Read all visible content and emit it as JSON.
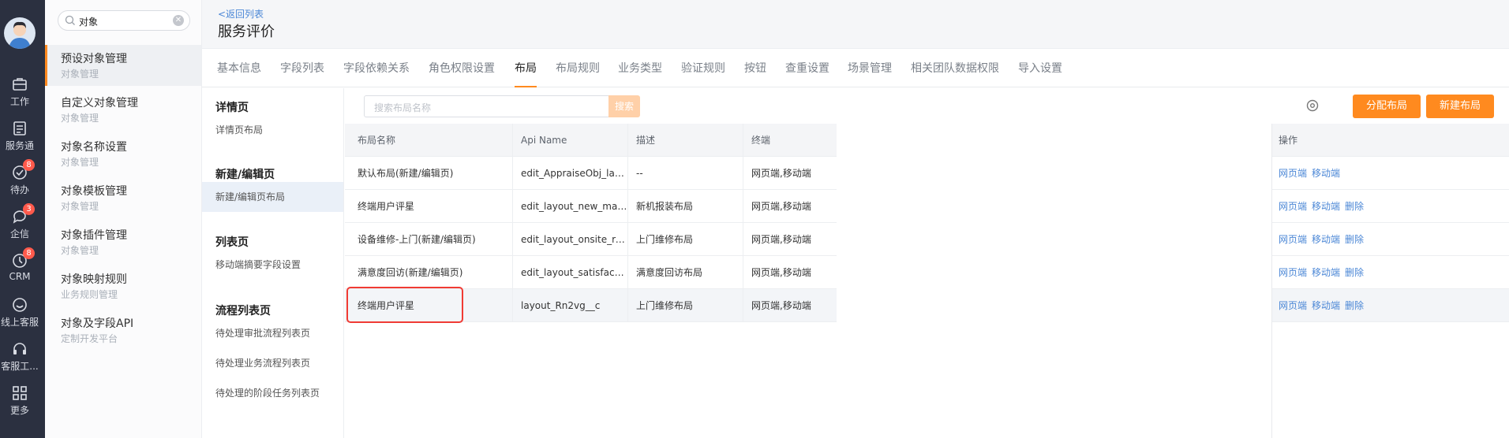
{
  "rail": [
    {
      "icon": "briefcase-icon",
      "label": "工作",
      "badge": ""
    },
    {
      "icon": "service-doc-icon",
      "label": "服务通",
      "badge": ""
    },
    {
      "icon": "check-circle-icon",
      "label": "待办",
      "badge": "8"
    },
    {
      "icon": "chat-icon",
      "label": "企信",
      "badge": "3"
    },
    {
      "icon": "clock-icon",
      "label": "CRM",
      "badge": "8"
    },
    {
      "icon": "smile-icon",
      "label": "线上客服",
      "badge": ""
    },
    {
      "icon": "headset-icon",
      "label": "客服工...",
      "badge": ""
    },
    {
      "icon": "grid-icon",
      "label": "更多",
      "badge": ""
    }
  ],
  "sidebar": {
    "search_value": "对象",
    "items": [
      {
        "title": "预设对象管理",
        "sub": "对象管理"
      },
      {
        "title": "自定义对象管理",
        "sub": "对象管理"
      },
      {
        "title": "对象名称设置",
        "sub": "对象管理"
      },
      {
        "title": "对象模板管理",
        "sub": "对象管理"
      },
      {
        "title": "对象插件管理",
        "sub": "对象管理"
      },
      {
        "title": "对象映射规则",
        "sub": "业务规则管理"
      },
      {
        "title": "对象及字段API",
        "sub": "定制开发平台"
      }
    ]
  },
  "header": {
    "back": "<返回列表",
    "title": "服务评价"
  },
  "tabs": [
    "基本信息",
    "字段列表",
    "字段依赖关系",
    "角色权限设置",
    "布局",
    "布局规则",
    "业务类型",
    "验证规则",
    "按钮",
    "查重设置",
    "场景管理",
    "相关团队数据权限",
    "导入设置"
  ],
  "subnav": {
    "sections": [
      {
        "title": "详情页",
        "items": [
          "详情页布局"
        ]
      },
      {
        "title": "新建/编辑页",
        "items": [
          "新建/编辑页布局"
        ]
      },
      {
        "title": "列表页",
        "items": [
          "移动端摘要字段设置"
        ]
      },
      {
        "title": "流程列表页",
        "items": [
          "待处理审批流程列表页",
          "待处理业务流程列表页",
          "待处理的阶段任务列表页"
        ]
      }
    ]
  },
  "toolbar": {
    "search_placeholder": "搜索布局名称",
    "search_button": "搜索",
    "assign_button": "分配布局",
    "new_button": "新建布局"
  },
  "table": {
    "columns": [
      "布局名称",
      "Api Name",
      "描述",
      "终端"
    ],
    "ops_header": "操作",
    "rows": [
      {
        "name": "默认布局(新建/编辑页)",
        "api": "edit_AppraiseObj_layout",
        "desc": "--",
        "terminal": "网页端,移动端",
        "ops": [
          "网页端",
          "移动端"
        ]
      },
      {
        "name": "终端用户评星",
        "api": "edit_layout_new_machine",
        "desc": "新机报装布局",
        "terminal": "网页端,移动端",
        "ops": [
          "网页端",
          "移动端",
          "删除"
        ]
      },
      {
        "name": "设备维修-上门(新建/编辑页)",
        "api": "edit_layout_onsite_repair",
        "desc": "上门维修布局",
        "terminal": "网页端,移动端",
        "ops": [
          "网页端",
          "移动端",
          "删除"
        ]
      },
      {
        "name": "满意度回访(新建/编辑页)",
        "api": "edit_layout_satisfaction",
        "desc": "满意度回访布局",
        "terminal": "网页端,移动端",
        "ops": [
          "网页端",
          "移动端",
          "删除"
        ]
      },
      {
        "name": "终端用户评星",
        "api": "layout_Rn2vg__c",
        "desc": "上门维修布局",
        "terminal": "网页端,移动端",
        "ops": [
          "网页端",
          "移动端",
          "删除"
        ]
      }
    ]
  },
  "colors": {
    "accent": "#ff8a1f",
    "link": "#4b87d6",
    "highlight": "#f03b34"
  }
}
